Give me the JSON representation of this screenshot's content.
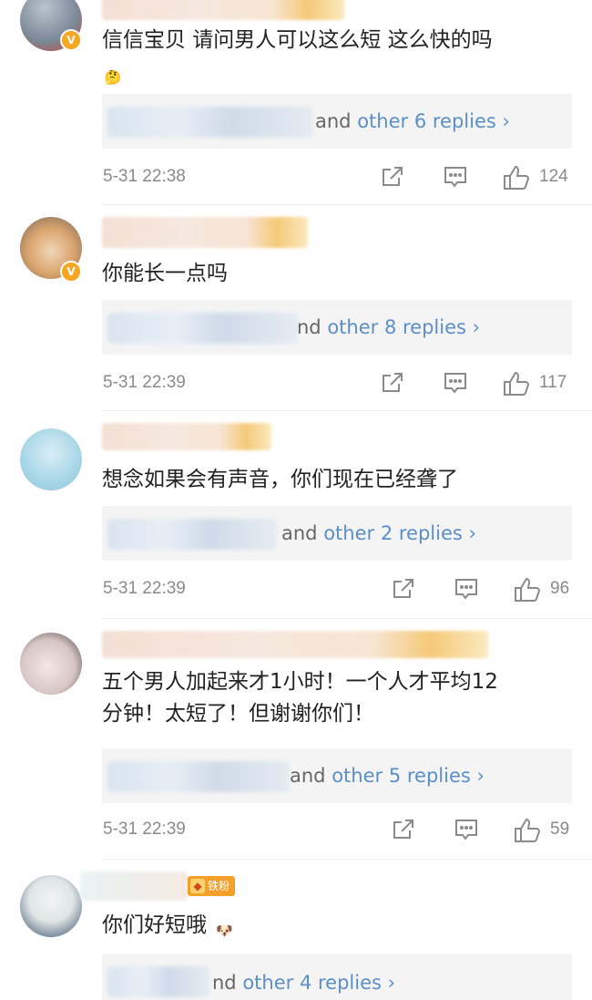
{
  "comments": [
    {
      "text": "信信宝贝  请问男人可以这么短 这么快的吗",
      "emoji": "🤔",
      "reply_prefix": "and",
      "reply_link": "other 6 replies",
      "timestamp": "5-31 22:38",
      "likes": "124"
    },
    {
      "text": "你能长一点吗",
      "reply_prefix": "nd",
      "reply_link": "other 8 replies",
      "timestamp": "5-31 22:39",
      "likes": "117"
    },
    {
      "text": "想念如果会有声音，你们现在已经聋了",
      "reply_prefix": "and",
      "reply_link": "other 2 replies",
      "timestamp": "5-31 22:39",
      "likes": "96"
    },
    {
      "text_line1": "五个男人加起来才1小时！一个人才平均12",
      "text_line2": "分钟！太短了！但谢谢你们！",
      "reply_prefix": "and",
      "reply_link": "other 5 replies",
      "timestamp": "5-31 22:39",
      "likes": "59"
    },
    {
      "badge": "铁粉",
      "text": "你们好短哦",
      "emoji": "🐶",
      "reply_prefix": "nd",
      "reply_link": "other 4 replies"
    }
  ],
  "icons": {
    "verified": "verified-badge",
    "repost": "repost-icon",
    "comment": "comment-icon",
    "like": "like-icon",
    "chevron": "chevron-right-icon"
  },
  "colors": {
    "link": "#5b8fc7",
    "verified": "#f5a623",
    "meta": "#8a8a8a"
  }
}
